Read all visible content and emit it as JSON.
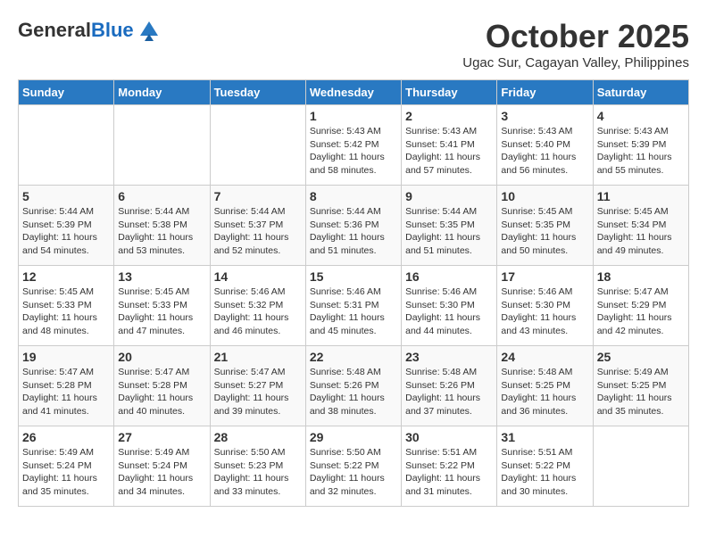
{
  "header": {
    "logo_general": "General",
    "logo_blue": "Blue",
    "month_title": "October 2025",
    "location": "Ugac Sur, Cagayan Valley, Philippines"
  },
  "days_of_week": [
    "Sunday",
    "Monday",
    "Tuesday",
    "Wednesday",
    "Thursday",
    "Friday",
    "Saturday"
  ],
  "weeks": [
    [
      {
        "day": "",
        "info": ""
      },
      {
        "day": "",
        "info": ""
      },
      {
        "day": "",
        "info": ""
      },
      {
        "day": "1",
        "info": "Sunrise: 5:43 AM\nSunset: 5:42 PM\nDaylight: 11 hours\nand 58 minutes."
      },
      {
        "day": "2",
        "info": "Sunrise: 5:43 AM\nSunset: 5:41 PM\nDaylight: 11 hours\nand 57 minutes."
      },
      {
        "day": "3",
        "info": "Sunrise: 5:43 AM\nSunset: 5:40 PM\nDaylight: 11 hours\nand 56 minutes."
      },
      {
        "day": "4",
        "info": "Sunrise: 5:43 AM\nSunset: 5:39 PM\nDaylight: 11 hours\nand 55 minutes."
      }
    ],
    [
      {
        "day": "5",
        "info": "Sunrise: 5:44 AM\nSunset: 5:39 PM\nDaylight: 11 hours\nand 54 minutes."
      },
      {
        "day": "6",
        "info": "Sunrise: 5:44 AM\nSunset: 5:38 PM\nDaylight: 11 hours\nand 53 minutes."
      },
      {
        "day": "7",
        "info": "Sunrise: 5:44 AM\nSunset: 5:37 PM\nDaylight: 11 hours\nand 52 minutes."
      },
      {
        "day": "8",
        "info": "Sunrise: 5:44 AM\nSunset: 5:36 PM\nDaylight: 11 hours\nand 51 minutes."
      },
      {
        "day": "9",
        "info": "Sunrise: 5:44 AM\nSunset: 5:35 PM\nDaylight: 11 hours\nand 51 minutes."
      },
      {
        "day": "10",
        "info": "Sunrise: 5:45 AM\nSunset: 5:35 PM\nDaylight: 11 hours\nand 50 minutes."
      },
      {
        "day": "11",
        "info": "Sunrise: 5:45 AM\nSunset: 5:34 PM\nDaylight: 11 hours\nand 49 minutes."
      }
    ],
    [
      {
        "day": "12",
        "info": "Sunrise: 5:45 AM\nSunset: 5:33 PM\nDaylight: 11 hours\nand 48 minutes."
      },
      {
        "day": "13",
        "info": "Sunrise: 5:45 AM\nSunset: 5:33 PM\nDaylight: 11 hours\nand 47 minutes."
      },
      {
        "day": "14",
        "info": "Sunrise: 5:46 AM\nSunset: 5:32 PM\nDaylight: 11 hours\nand 46 minutes."
      },
      {
        "day": "15",
        "info": "Sunrise: 5:46 AM\nSunset: 5:31 PM\nDaylight: 11 hours\nand 45 minutes."
      },
      {
        "day": "16",
        "info": "Sunrise: 5:46 AM\nSunset: 5:30 PM\nDaylight: 11 hours\nand 44 minutes."
      },
      {
        "day": "17",
        "info": "Sunrise: 5:46 AM\nSunset: 5:30 PM\nDaylight: 11 hours\nand 43 minutes."
      },
      {
        "day": "18",
        "info": "Sunrise: 5:47 AM\nSunset: 5:29 PM\nDaylight: 11 hours\nand 42 minutes."
      }
    ],
    [
      {
        "day": "19",
        "info": "Sunrise: 5:47 AM\nSunset: 5:28 PM\nDaylight: 11 hours\nand 41 minutes."
      },
      {
        "day": "20",
        "info": "Sunrise: 5:47 AM\nSunset: 5:28 PM\nDaylight: 11 hours\nand 40 minutes."
      },
      {
        "day": "21",
        "info": "Sunrise: 5:47 AM\nSunset: 5:27 PM\nDaylight: 11 hours\nand 39 minutes."
      },
      {
        "day": "22",
        "info": "Sunrise: 5:48 AM\nSunset: 5:26 PM\nDaylight: 11 hours\nand 38 minutes."
      },
      {
        "day": "23",
        "info": "Sunrise: 5:48 AM\nSunset: 5:26 PM\nDaylight: 11 hours\nand 37 minutes."
      },
      {
        "day": "24",
        "info": "Sunrise: 5:48 AM\nSunset: 5:25 PM\nDaylight: 11 hours\nand 36 minutes."
      },
      {
        "day": "25",
        "info": "Sunrise: 5:49 AM\nSunset: 5:25 PM\nDaylight: 11 hours\nand 35 minutes."
      }
    ],
    [
      {
        "day": "26",
        "info": "Sunrise: 5:49 AM\nSunset: 5:24 PM\nDaylight: 11 hours\nand 35 minutes."
      },
      {
        "day": "27",
        "info": "Sunrise: 5:49 AM\nSunset: 5:24 PM\nDaylight: 11 hours\nand 34 minutes."
      },
      {
        "day": "28",
        "info": "Sunrise: 5:50 AM\nSunset: 5:23 PM\nDaylight: 11 hours\nand 33 minutes."
      },
      {
        "day": "29",
        "info": "Sunrise: 5:50 AM\nSunset: 5:22 PM\nDaylight: 11 hours\nand 32 minutes."
      },
      {
        "day": "30",
        "info": "Sunrise: 5:51 AM\nSunset: 5:22 PM\nDaylight: 11 hours\nand 31 minutes."
      },
      {
        "day": "31",
        "info": "Sunrise: 5:51 AM\nSunset: 5:22 PM\nDaylight: 11 hours\nand 30 minutes."
      },
      {
        "day": "",
        "info": ""
      }
    ]
  ]
}
